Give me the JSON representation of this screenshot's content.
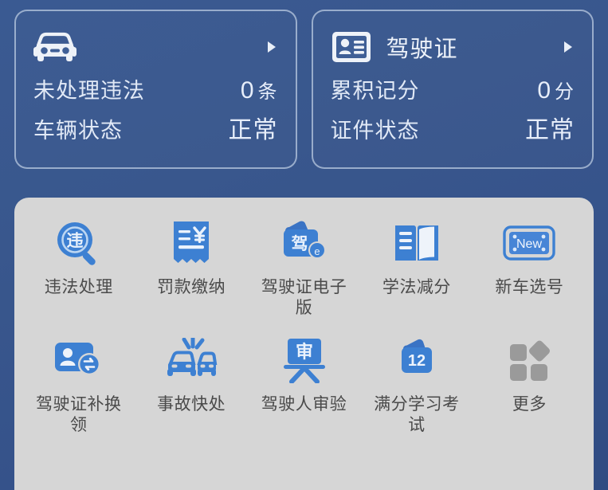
{
  "theme": {
    "background_top": "#3a5a92",
    "background_bottom": "#2f4b82",
    "panel_bg": "#d6d6d6",
    "icon_blue": "#3b7ed0",
    "icon_blue_dark": "#2f6dc2",
    "icon_gray": "#9a9a9a",
    "card_text": "#eef3fa",
    "label_text": "#4a4a4a"
  },
  "cards": [
    {
      "id": "vehicle",
      "icon": "car-icon",
      "title": "",
      "title_masked": true,
      "chevron": "chevron-right-icon",
      "rows": [
        {
          "label": "未处理违法",
          "value": "0",
          "unit": "条"
        },
        {
          "label": "车辆状态",
          "value": "正常",
          "unit": ""
        }
      ]
    },
    {
      "id": "license",
      "icon": "id-card-icon",
      "title": "驾驶证",
      "title_masked": false,
      "chevron": "chevron-right-icon",
      "rows": [
        {
          "label": "累积记分",
          "value": "0",
          "unit": "分"
        },
        {
          "label": "证件状态",
          "value": "正常",
          "unit": ""
        }
      ]
    }
  ],
  "grid": {
    "rows": [
      [
        {
          "id": "violation-handling",
          "icon": "violation-search-icon",
          "label": "违法处理",
          "glyph": "违"
        },
        {
          "id": "fine-payment",
          "icon": "receipt-yuan-icon",
          "label": "罚款缴纳",
          "glyph": "¥"
        },
        {
          "id": "e-license",
          "icon": "e-license-wallet-icon",
          "label": "驾驶证电子版",
          "glyph": "驾",
          "badge": "e"
        },
        {
          "id": "law-study-points",
          "icon": "open-book-icon",
          "label": "学法减分",
          "glyph": ""
        },
        {
          "id": "new-plate-selection",
          "icon": "new-plate-icon",
          "label": "新车选号",
          "glyph": "New"
        }
      ],
      [
        {
          "id": "license-replacement",
          "icon": "license-renew-icon",
          "label": "驾驶证补换领",
          "glyph": ""
        },
        {
          "id": "accident-quick-handling",
          "icon": "car-crash-icon",
          "label": "事故快处",
          "glyph": ""
        },
        {
          "id": "driver-review",
          "icon": "review-board-icon",
          "label": "驾驶人审验",
          "glyph": "审"
        },
        {
          "id": "full-points-exam",
          "icon": "points-12-icon",
          "label": "满分学习考试",
          "glyph": "12"
        },
        {
          "id": "more",
          "icon": "more-grid-icon",
          "label": "更多",
          "glyph": ""
        }
      ]
    ]
  }
}
